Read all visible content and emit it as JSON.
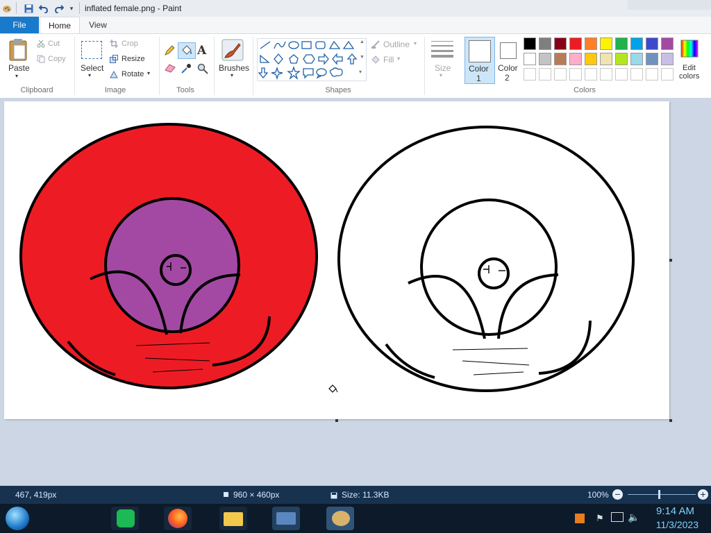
{
  "window": {
    "title": "inflated female.png - Paint"
  },
  "tabs": {
    "file": "File",
    "home": "Home",
    "view": "View"
  },
  "clipboard": {
    "paste": "Paste",
    "cut": "Cut",
    "copy": "Copy",
    "group": "Clipboard"
  },
  "image": {
    "select": "Select",
    "crop": "Crop",
    "resize": "Resize",
    "rotate": "Rotate",
    "group": "Image"
  },
  "tools": {
    "group": "Tools"
  },
  "brushes": {
    "label": "Brushes"
  },
  "shapes": {
    "outline": "Outline",
    "fill": "Fill",
    "group": "Shapes"
  },
  "size": {
    "label": "Size"
  },
  "colors": {
    "color1_label": "Color",
    "color1_num": "1",
    "color2_label": "Color",
    "color2_num": "2",
    "edit_line1": "Edit",
    "edit_line2": "colors",
    "group": "Colors",
    "palette": [
      "#000000",
      "#7f7f7f",
      "#880015",
      "#ed1c24",
      "#ff7f27",
      "#fff200",
      "#22b14c",
      "#00a2e8",
      "#3f48cc",
      "#a349a4",
      "#ffffff",
      "#c3c3c3",
      "#b97a57",
      "#ffaec9",
      "#ffc90e",
      "#efe4b0",
      "#b5e61d",
      "#99d9ea",
      "#7092be",
      "#c8bfe7"
    ],
    "fill_red": "#ed1c24",
    "fill_purple": "#a349a4"
  },
  "status": {
    "cursor_pos": "467, 419px",
    "dimensions": "960 × 460px",
    "file_size": "Size: 11.3KB",
    "zoom": "100%"
  },
  "taskbar": {
    "time": "9:14 AM",
    "date": "11/3/2023"
  }
}
